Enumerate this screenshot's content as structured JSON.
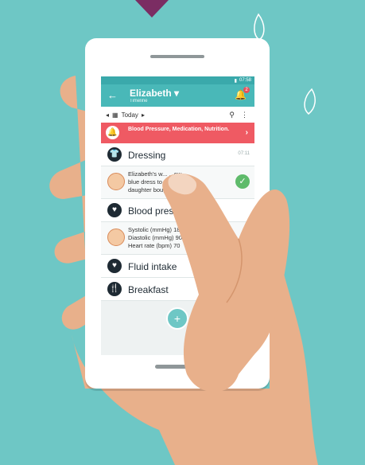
{
  "colors": {
    "background": "#6ec7c5",
    "teal": "#49b8b8",
    "alert": "#ef5a63",
    "skin": "#e8b08b",
    "check": "#5fbb6b"
  },
  "status_bar": {
    "time": "07:58"
  },
  "app_bar": {
    "back_icon": "back-arrow-icon",
    "title": "Elizabeth ▾",
    "subtitle": "Timeline",
    "bell_icon": "bell-icon",
    "badge_count": "2"
  },
  "date_bar": {
    "prev": "◂",
    "label": "Today",
    "next": "▸",
    "search_icon": "search-icon",
    "menu_icon": "more-vert-icon"
  },
  "alert": {
    "text": "Blood Pressure, Medication, Nutrition.",
    "icon": "warning-bell-icon",
    "chevron": "›"
  },
  "timeline": [
    {
      "type": "header",
      "title": "Dressing",
      "time": "07:11",
      "icon": "shirt-icon"
    },
    {
      "type": "detail",
      "lines": [
        "Elizabeth's w... ...ew",
        "blue dress to...",
        "daughter boug..."
      ],
      "checked": true
    },
    {
      "type": "header",
      "title": "Blood pressure",
      "time": "",
      "icon": "heart-icon"
    },
    {
      "type": "detail",
      "lines": [
        "Systolic (mmHg) 180",
        "Diastolic (mmHg) 90",
        "Heart rate (bpm) 70"
      ],
      "checked": false
    },
    {
      "type": "header",
      "title": "Fluid intake",
      "time": "",
      "icon": "heart-icon"
    },
    {
      "type": "header",
      "title": "Breakfast",
      "time": "",
      "icon": "cutlery-icon"
    }
  ],
  "fab": {
    "label": "+"
  }
}
